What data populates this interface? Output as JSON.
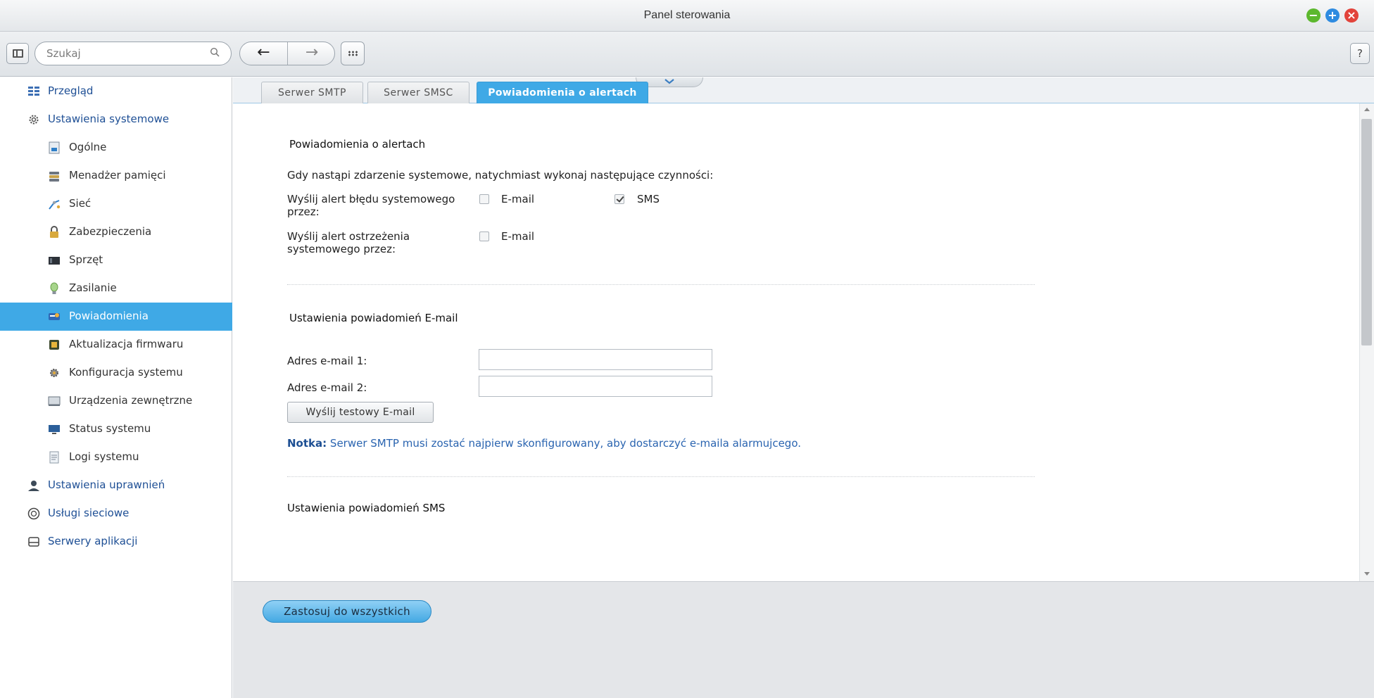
{
  "window": {
    "title": "Panel sterowania",
    "controls": {
      "minimize": "−",
      "maximize": "+",
      "close": "×"
    }
  },
  "toolbar": {
    "search_placeholder": "Szukaj",
    "back_label": "←",
    "forward_label": "→",
    "help_label": "?"
  },
  "sidebar": {
    "items": [
      {
        "label": "Przegląd",
        "icon": "overview-icon",
        "level": "top"
      },
      {
        "label": "Ustawienia systemowe",
        "icon": "gear-icon",
        "level": "top"
      },
      {
        "label": "Ogólne",
        "icon": "general-icon",
        "level": "sub"
      },
      {
        "label": "Menadżer pamięci",
        "icon": "storage-icon",
        "level": "sub"
      },
      {
        "label": "Sieć",
        "icon": "network-icon",
        "level": "sub"
      },
      {
        "label": "Zabezpieczenia",
        "icon": "lock-icon",
        "level": "sub"
      },
      {
        "label": "Sprzęt",
        "icon": "hardware-icon",
        "level": "sub"
      },
      {
        "label": "Zasilanie",
        "icon": "power-icon",
        "level": "sub"
      },
      {
        "label": "Powiadomienia",
        "icon": "notification-icon",
        "level": "sub",
        "active": true
      },
      {
        "label": "Aktualizacja firmwaru",
        "icon": "firmware-icon",
        "level": "sub"
      },
      {
        "label": "Konfiguracja systemu",
        "icon": "config-icon",
        "level": "sub"
      },
      {
        "label": "Urządzenia zewnętrzne",
        "icon": "external-device-icon",
        "level": "sub"
      },
      {
        "label": "Status systemu",
        "icon": "monitor-icon",
        "level": "sub"
      },
      {
        "label": "Logi systemu",
        "icon": "log-icon",
        "level": "sub"
      },
      {
        "label": "Ustawienia uprawnień",
        "icon": "user-icon",
        "level": "top"
      },
      {
        "label": "Usługi sieciowe",
        "icon": "network-services-icon",
        "level": "top"
      },
      {
        "label": "Serwery aplikacji",
        "icon": "app-server-icon",
        "level": "top"
      }
    ]
  },
  "tabs": [
    {
      "label": "Serwer SMTP"
    },
    {
      "label": "Serwer SMSC"
    },
    {
      "label": "Powiadomienia o alertach",
      "active": true
    }
  ],
  "alerts": {
    "title": "Powiadomienia o alertach",
    "description": "Gdy nastąpi zdarzenie systemowe, natychmiast wykonaj następujące czynności:",
    "error_label_line1": "Wyślij alert błędu systemowego",
    "error_label_line2": "przez:",
    "warning_label_line1": "Wyślij alert ostrzeżenia",
    "warning_label_line2": "systemowego przez:",
    "email_label": "E-mail",
    "sms_label": "SMS",
    "error_email_checked": false,
    "error_sms_checked": true,
    "warning_email_checked": false
  },
  "email_settings": {
    "title": "Ustawienia powiadomień E-mail",
    "address1_label": "Adres e-mail 1:",
    "address2_label": "Adres e-mail 2:",
    "address1_value": "",
    "address2_value": "",
    "test_button": "Wyślij testowy E-mail",
    "note_prefix": "Notka:",
    "note_text": "Serwer SMTP musi zostać najpierw skonfigurowany, aby dostarczyć e-maila alarmujcego."
  },
  "sms_settings": {
    "title": "Ustawienia powiadomień SMS"
  },
  "footer": {
    "apply_all_button": "Zastosuj do wszystkich"
  },
  "colors": {
    "accent": "#3fa9e6",
    "link": "#1e4f95",
    "minimize": "#5cb82e",
    "maximize": "#2e8be0",
    "close": "#e2433b"
  }
}
